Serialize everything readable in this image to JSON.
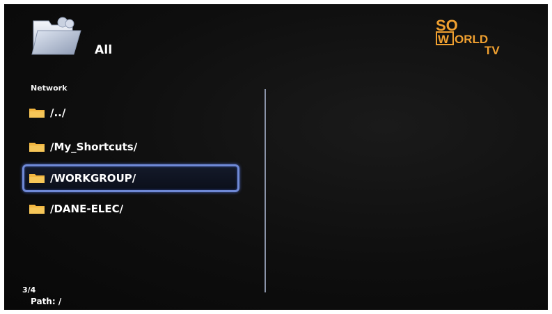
{
  "header": {
    "title": "All",
    "folder_icon": "folder-icon"
  },
  "logo": {
    "line1": "SO",
    "line2_boxed": "W",
    "line2_rest": "ORLD",
    "line3": "TV",
    "color": "#f0a030"
  },
  "section": {
    "label": "Network"
  },
  "files": [
    {
      "label": "/../",
      "selected": false
    },
    {
      "label": "/My_Shortcuts/",
      "selected": false
    },
    {
      "label": "/WORKGROUP/",
      "selected": true
    },
    {
      "label": "/DANE-ELEC/",
      "selected": false
    }
  ],
  "footer": {
    "page_count": "3/4",
    "path": "Path: /"
  },
  "colors": {
    "background": "#0e0e0e",
    "selection_border": "#6f89d6",
    "folder": "#f2b640",
    "text": "#ffffff"
  }
}
